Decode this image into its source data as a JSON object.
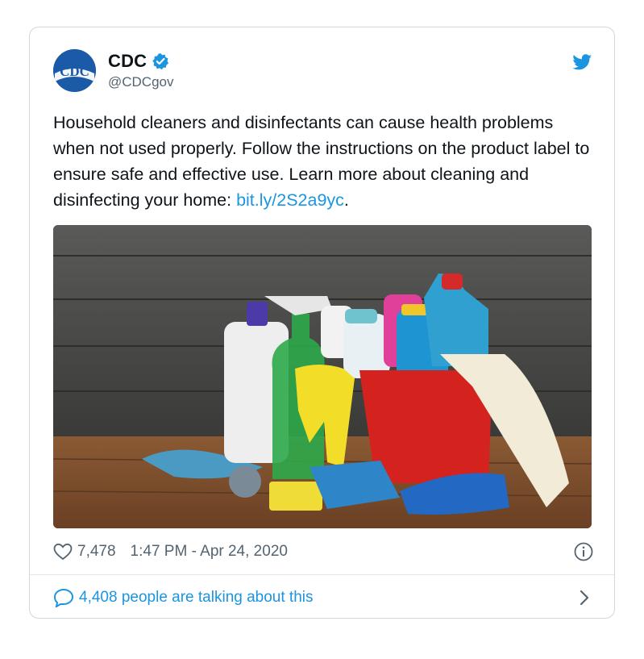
{
  "tweet": {
    "avatar_text": "CDC",
    "display_name": "CDC",
    "handle": "@CDCgov",
    "text_before_link": "Household cleaners and disinfectants can cause health problems when not used properly. Follow the instructions on the product label to ensure safe and effective use. Learn more about cleaning and disinfecting your home: ",
    "link": "bit.ly/2S2a9yc",
    "text_after_link": ".",
    "likes": "7,478",
    "timestamp": "1:47 PM - Apr 24, 2020",
    "talking": "4,408 people are talking about this"
  },
  "icons": {
    "verified": "verified-badge-icon",
    "bird": "twitter-bird-icon",
    "heart": "heart-icon",
    "info": "info-icon",
    "bubble": "reply-bubble-icon",
    "chevron": "chevron-right-icon"
  },
  "colors": {
    "link": "#1b95e0",
    "avatar": "#1a5aa6",
    "text": "#0f1419",
    "muted": "#536471"
  }
}
